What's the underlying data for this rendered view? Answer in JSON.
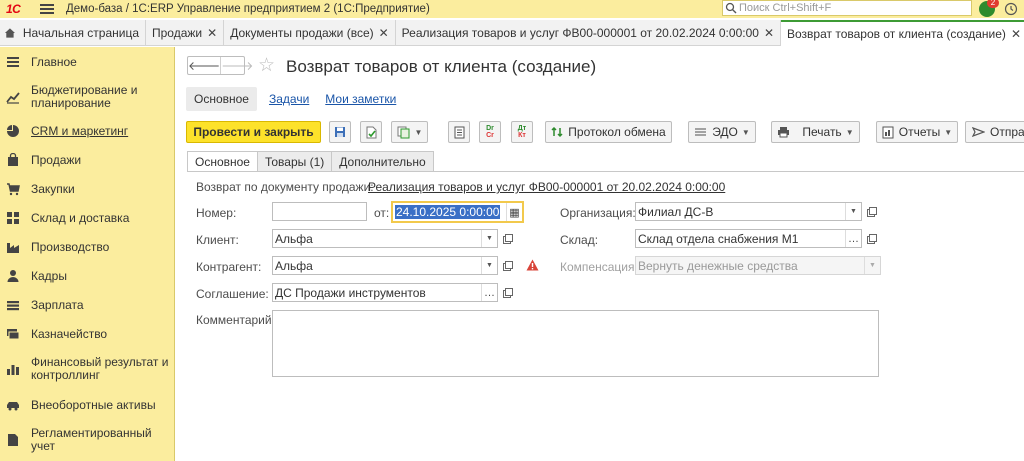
{
  "titlebar": {
    "logo": "1С",
    "title": "Демо-база / 1С:ERP Управление предприятием 2  (1С:Предприятие)",
    "search_placeholder": "Поиск Ctrl+Shift+F",
    "notif_count": "2"
  },
  "tabs": [
    {
      "label": "Начальная страница",
      "closable": false
    },
    {
      "label": "Продажи",
      "closable": true
    },
    {
      "label": "Документы продажи (все)",
      "closable": true
    },
    {
      "label": "Реализация товаров и услуг ФВ00-000001 от 20.02.2024 0:00:00",
      "closable": true
    },
    {
      "label": "Возврат товаров от клиента (создание)",
      "closable": true,
      "active": true
    }
  ],
  "sidebar": {
    "items": [
      {
        "label": "Главное",
        "icon": "menu-lines-icon"
      },
      {
        "label": "Бюджетирование и планирование",
        "icon": "budget-chart-icon"
      },
      {
        "label": "CRM и маркетинг",
        "icon": "crm-pie-icon"
      },
      {
        "label": "Продажи",
        "icon": "sales-bag-icon"
      },
      {
        "label": "Закупки",
        "icon": "cart-icon"
      },
      {
        "label": "Склад и доставка",
        "icon": "warehouse-grid-icon"
      },
      {
        "label": "Производство",
        "icon": "factory-icon"
      },
      {
        "label": "Кадры",
        "icon": "person-icon"
      },
      {
        "label": "Зарплата",
        "icon": "salary-icon"
      },
      {
        "label": "Казначейство",
        "icon": "treasury-icon"
      },
      {
        "label": "Финансовый результат и контроллинг",
        "icon": "bar-chart-icon"
      },
      {
        "label": "Внеоборотные активы",
        "icon": "car-icon"
      },
      {
        "label": "Регламентированный учет",
        "icon": "document-icon"
      }
    ]
  },
  "form": {
    "title": "Возврат товаров от клиента (создание)",
    "subnav": [
      "Основное",
      "Задачи",
      "Мои заметки"
    ],
    "toolbar": {
      "post_close": "Провести и закрыть",
      "exchange_protocol": "Протокол обмена",
      "edo": "ЭДО",
      "print": "Печать",
      "reports": "Отчеты",
      "send": "Отпра"
    },
    "tabs": [
      "Основное",
      "Товары (1)",
      "Дополнительно"
    ],
    "basis_label": "Возврат по документу продажи:",
    "basis_link": "Реализация товаров и услуг ФВ00-000001 от 20.02.2024 0:00:00",
    "number_label": "Номер:",
    "number_value": "",
    "date_label": "от:",
    "date_value": "24.10.2025  0:00:00",
    "organization_label": "Организация:",
    "organization_value": "Филиал ДС-В",
    "client_label": "Клиент:",
    "client_value": "Альфа",
    "warehouse_label": "Склад:",
    "warehouse_value": "Склад отдела снабжения М1",
    "counterparty_label": "Контрагент:",
    "counterparty_value": "Альфа",
    "compensation_label": "Компенсация:",
    "compensation_value": "Вернуть денежные средства",
    "agreement_label": "Соглашение:",
    "agreement_value": "ДС Продажи инструментов",
    "comment_label": "Комментарий:",
    "comment_value": ""
  },
  "colors": {
    "sidebar_bg": "#fbed9e",
    "primary_button": "#fde22a",
    "active_tab_accent": "#3d9b35",
    "link": "#1a55a8",
    "warning": "#d9453a"
  }
}
